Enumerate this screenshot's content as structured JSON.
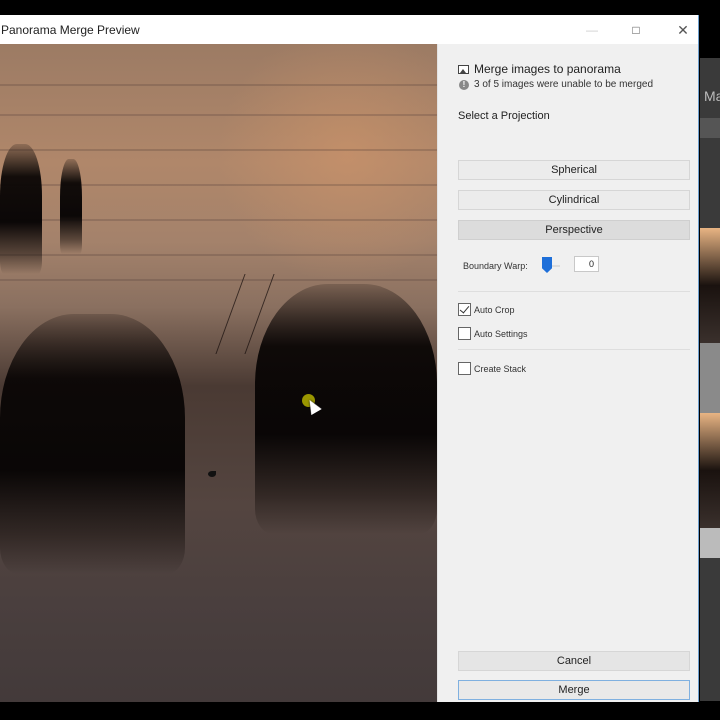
{
  "window": {
    "title": "Panorama Merge Preview",
    "minimize_glyph": "—",
    "maximize_glyph": "□",
    "close_glyph": "✕"
  },
  "panel": {
    "header": "Merge images to panorama",
    "warning": "3 of 5 images were unable to be merged",
    "projection_label": "Select a Projection",
    "projections": [
      {
        "label": "Spherical",
        "selected": false
      },
      {
        "label": "Cylindrical",
        "selected": false
      },
      {
        "label": "Perspective",
        "selected": true
      }
    ],
    "boundary_warp": {
      "label": "Boundary Warp:",
      "value": "0",
      "slider_fraction": 0,
      "accent": "#1e6fd9"
    },
    "options": [
      {
        "label": "Auto Crop",
        "checked": true
      },
      {
        "label": "Auto Settings",
        "checked": false
      },
      {
        "label": "Create Stack",
        "checked": false
      }
    ],
    "cancel_label": "Cancel",
    "merge_label": "Merge"
  },
  "background_app": {
    "title_fragment": "Ma"
  }
}
